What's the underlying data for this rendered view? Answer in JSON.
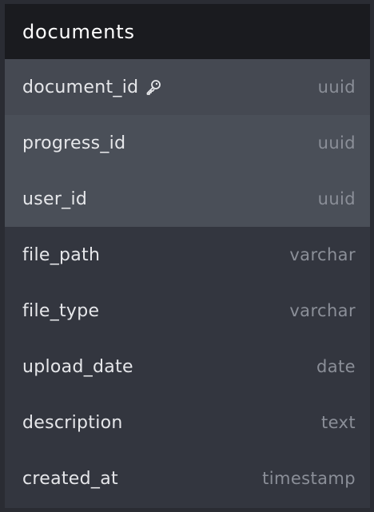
{
  "table": {
    "name": "documents",
    "columns": [
      {
        "name": "document_id",
        "type": "uuid",
        "primary_key": true,
        "icon": "key-icon"
      },
      {
        "name": "progress_id",
        "type": "uuid"
      },
      {
        "name": "user_id",
        "type": "uuid"
      },
      {
        "name": "file_path",
        "type": "varchar"
      },
      {
        "name": "file_type",
        "type": "varchar"
      },
      {
        "name": "upload_date",
        "type": "date"
      },
      {
        "name": "description",
        "type": "text"
      },
      {
        "name": "created_at",
        "type": "timestamp"
      }
    ]
  },
  "colors": {
    "header_bg": "#1a1b1f",
    "body_bg": "#33363f",
    "primary_row_bg": "#454952",
    "foreign_row_bg": "#4a4f58",
    "type_text": "#8b8f98"
  }
}
